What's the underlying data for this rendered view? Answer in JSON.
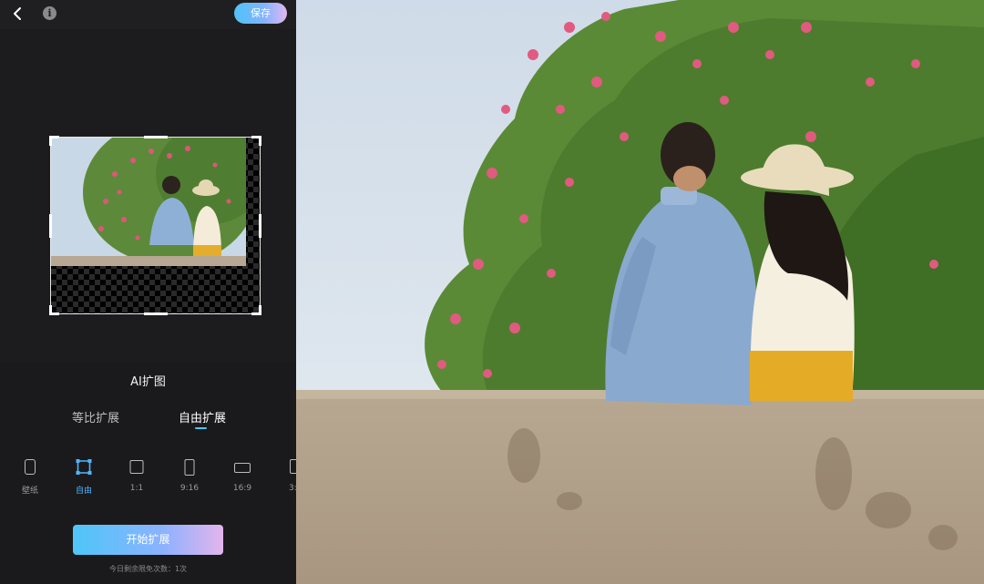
{
  "header": {
    "save_label": "保存"
  },
  "panel": {
    "title": "AI扩图",
    "tabs": [
      {
        "label": "等比扩展",
        "active": false
      },
      {
        "label": "自由扩展",
        "active": true
      }
    ],
    "ratios": [
      {
        "label": "壁纸",
        "icon": "phone-icon",
        "selected": false
      },
      {
        "label": "自由",
        "icon": "free-crop-icon",
        "selected": true
      },
      {
        "label": "1:1",
        "icon": "square-icon",
        "selected": false
      },
      {
        "label": "9:16",
        "icon": "portrait-icon",
        "selected": false
      },
      {
        "label": "16:9",
        "icon": "landscape-icon",
        "selected": false
      },
      {
        "label": "3:",
        "icon": "ratio-icon",
        "selected": false
      }
    ],
    "start_label": "开始扩展",
    "quota_text": "今日剩余限免次数：1次"
  },
  "colors": {
    "accent": "#4fb6ff",
    "panel_bg": "#1f1f21"
  }
}
